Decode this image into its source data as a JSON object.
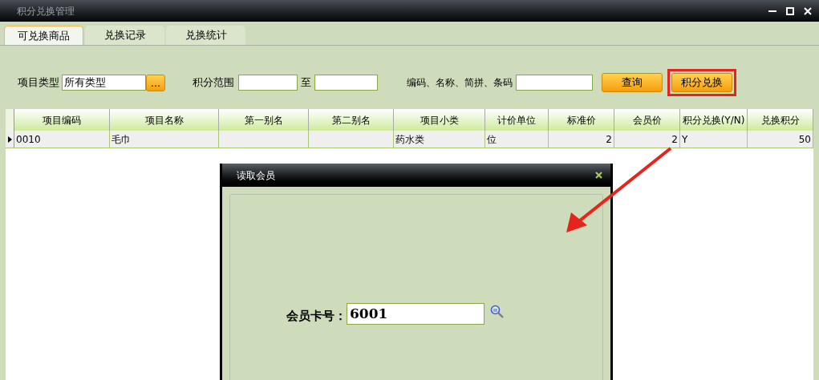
{
  "window": {
    "title": "积分兑换管理"
  },
  "tabs": [
    {
      "label": "可兑换商品",
      "selected": true
    },
    {
      "label": "兑换记录",
      "selected": false
    },
    {
      "label": "兑换统计",
      "selected": false
    }
  ],
  "filters": {
    "type_label": "项目类型",
    "type_value": "所有类型",
    "browse_button": "...",
    "range_label": "积分范围",
    "range_to": "至",
    "keyword_label": "编码、名称、简拼、条码",
    "query_button": "查询",
    "exchange_button": "积分兑换"
  },
  "table": {
    "columns": [
      "项目编码",
      "项目名称",
      "第一别名",
      "第二别名",
      "项目小类",
      "计价单位",
      "标准价",
      "会员价",
      "积分兑换(Y/N)",
      "兑换积分"
    ],
    "rows": [
      {
        "current": true,
        "cells": [
          "0010",
          "毛巾",
          "",
          "",
          "药水类",
          "位",
          "2",
          "2",
          "Y",
          "50"
        ]
      }
    ]
  },
  "dialog": {
    "title": "读取会员",
    "card_label": "会员卡号：",
    "card_value": "6001"
  }
}
